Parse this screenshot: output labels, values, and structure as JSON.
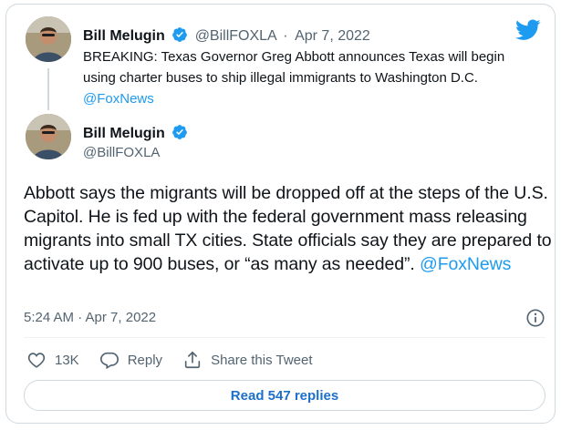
{
  "colors": {
    "accent": "#1d9bf0",
    "muted": "#536471",
    "text": "#0f1419",
    "border": "#cfd9de"
  },
  "icons": [
    "twitter-bird-icon",
    "verified-badge-icon",
    "info-icon",
    "heart-icon",
    "reply-icon",
    "share-icon"
  ],
  "quoted_tweet": {
    "name": "Bill Melugin",
    "handle": "@BillFOXLA",
    "separator": "·",
    "date": "Apr 7, 2022",
    "text": "BREAKING: Texas Governor Greg Abbott announces Texas will begin using charter buses to ship illegal immigrants to Washington D.C.",
    "mention": "@FoxNews"
  },
  "main_tweet": {
    "name": "Bill Melugin",
    "handle": "@BillFOXLA",
    "text": "Abbott says the migrants will be dropped off at the steps of the U.S. Capitol. He is fed up with the federal government mass releasing migrants into small TX cities. State officials say they are prepared to activate up to 900 buses, or “as many as needed”.",
    "mention": "@FoxNews",
    "timestamp": "5:24 AM · Apr 7, 2022"
  },
  "actions": {
    "likes": "13K",
    "reply_label": "Reply",
    "share_label": "Share this Tweet"
  },
  "read_replies": "Read 547 replies"
}
